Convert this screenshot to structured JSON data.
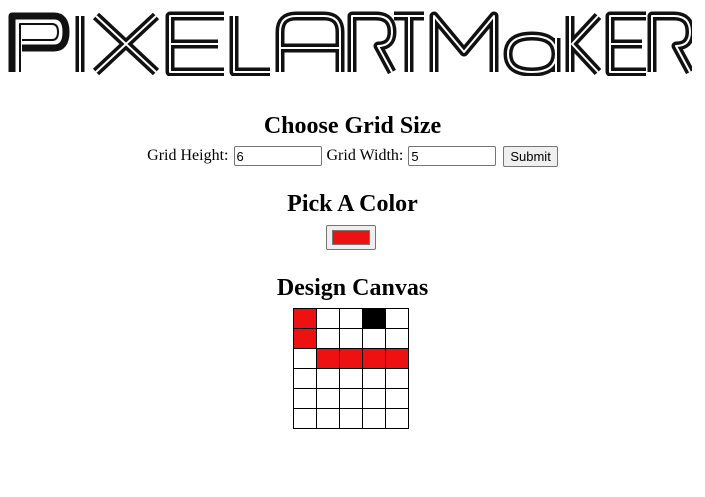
{
  "header": {
    "logo_text": "Pixel Art Maker"
  },
  "grid_size": {
    "title": "Choose Grid Size",
    "height_label": "Grid Height:",
    "height_value": "6",
    "width_label": "Grid Width:",
    "width_value": "5",
    "submit_label": "Submit"
  },
  "color": {
    "title": "Pick A Color",
    "value": "#ee1111"
  },
  "canvas": {
    "title": "Design Canvas",
    "rows": 6,
    "cols": 5,
    "cells": [
      [
        "#ee1111",
        "",
        "",
        "#000000",
        ""
      ],
      [
        "#ee1111",
        "",
        "",
        "",
        ""
      ],
      [
        "",
        "#ee1111",
        "#ee1111",
        "#ee1111",
        "#ee1111"
      ],
      [
        "",
        "",
        "",
        "",
        ""
      ],
      [
        "",
        "",
        "",
        "",
        ""
      ],
      [
        "",
        "",
        "",
        "",
        ""
      ]
    ]
  }
}
